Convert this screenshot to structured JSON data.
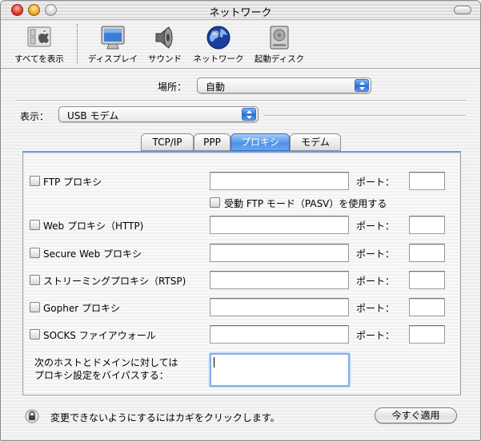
{
  "window": {
    "title": "ネットワーク"
  },
  "toolbar": {
    "items": [
      {
        "label": "すべてを表示",
        "icon": "apple-panel-icon"
      },
      {
        "label": "ディスプレイ",
        "icon": "display-icon"
      },
      {
        "label": "サウンド",
        "icon": "speaker-icon"
      },
      {
        "label": "ネットワーク",
        "icon": "globe-icon"
      },
      {
        "label": "起動ディスク",
        "icon": "hard-disk-icon"
      }
    ]
  },
  "location": {
    "label": "場所：",
    "value": "自動"
  },
  "show": {
    "label": "表示：",
    "value": "USB モデム"
  },
  "tabs": [
    {
      "label": "TCP/IP",
      "active": false
    },
    {
      "label": "PPP",
      "active": false
    },
    {
      "label": "プロキシ",
      "active": true
    },
    {
      "label": "モデム",
      "active": false
    }
  ],
  "proxies": [
    {
      "label": "FTP プロキシ",
      "checked": false,
      "host": "",
      "port": ""
    },
    {
      "label": "Web プロキシ（HTTP)",
      "checked": false,
      "host": "",
      "port": ""
    },
    {
      "label": "Secure Web プロキシ",
      "checked": false,
      "host": "",
      "port": ""
    },
    {
      "label": "ストリーミングプロキシ（RTSP)",
      "checked": false,
      "host": "",
      "port": ""
    },
    {
      "label": "Gopher プロキシ",
      "checked": false,
      "host": "",
      "port": ""
    },
    {
      "label": "SOCKS ファイアウォール",
      "checked": false,
      "host": "",
      "port": ""
    }
  ],
  "port_label": "ポート：",
  "pasv": {
    "label": "受動 FTP モード（PASV）を使用する",
    "checked": false
  },
  "bypass": {
    "line1": "次のホストとドメインに対しては",
    "line2": "プロキシ設定をバイパスする：",
    "value": ""
  },
  "footer": {
    "lock_text": "変更できないようにするにはカギをクリックします。",
    "apply_label": "今すぐ適用"
  },
  "colors": {
    "accent": "#3f86e6",
    "active_tab": "#4f93e9"
  }
}
